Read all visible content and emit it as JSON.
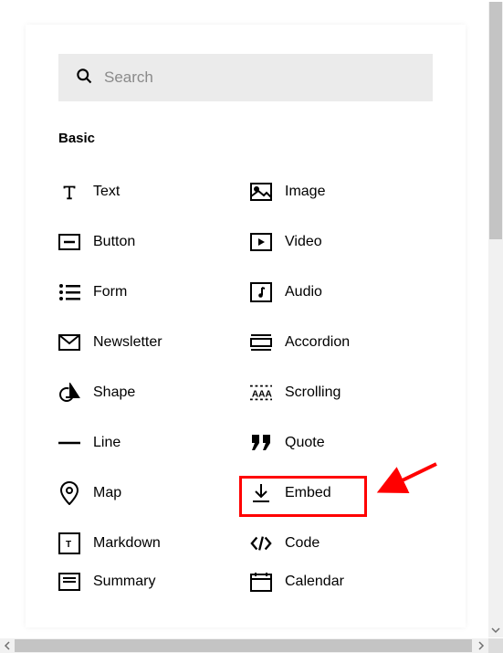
{
  "search": {
    "placeholder": "Search",
    "value": ""
  },
  "section_title": "Basic",
  "items": {
    "text": "Text",
    "image": "Image",
    "button": "Button",
    "video": "Video",
    "form": "Form",
    "audio": "Audio",
    "newsletter": "Newsletter",
    "accordion": "Accordion",
    "shape": "Shape",
    "scrolling": "Scrolling",
    "line": "Line",
    "quote": "Quote",
    "map": "Map",
    "embed": "Embed",
    "markdown": "Markdown",
    "code": "Code",
    "summary": "Summary",
    "calendar": "Calendar"
  },
  "annotations": {
    "highlight": "embed",
    "highlight_color": "#ff0000",
    "arrow_color": "#ff0000"
  }
}
